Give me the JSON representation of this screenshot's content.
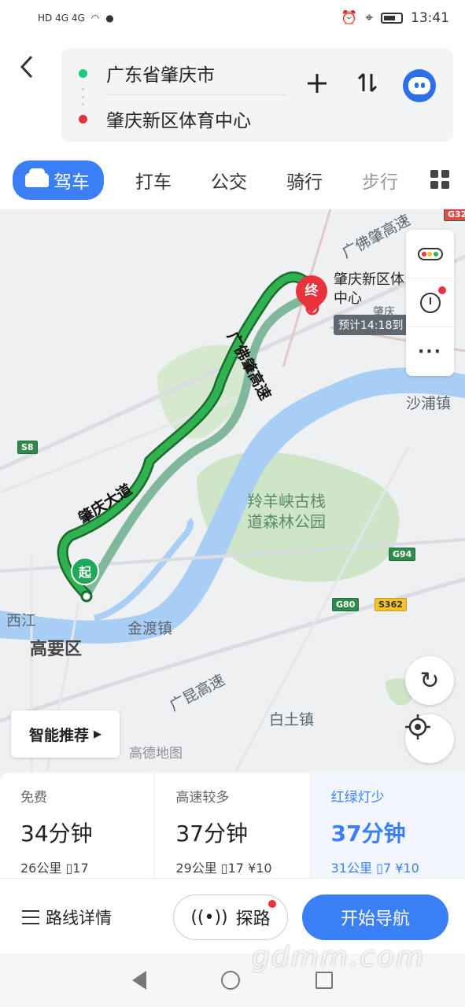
{
  "status_bar": {
    "network": "HD 4G 4G",
    "time": "13:41"
  },
  "header": {
    "back_icon": "chevron-left-icon",
    "start": "广东省肇庆市",
    "end": "肇庆新区体育中心",
    "add_icon": "plus-icon",
    "swap_icon": "swap-vertical-icon",
    "assistant_icon": "robot-icon"
  },
  "mode_tabs": [
    {
      "label": "驾车",
      "active": true
    },
    {
      "label": "打车"
    },
    {
      "label": "公交"
    },
    {
      "label": "骑行"
    },
    {
      "label": "步行"
    }
  ],
  "map": {
    "dest_name": "肇庆新区体育中心",
    "dest_line1": "肇庆新区体",
    "dest_line2": "中心",
    "eta": "预计14:18到",
    "end_marker": "终",
    "start_marker": "起",
    "labels": {
      "guangfo_top": "广佛肇高速",
      "guangfo_route": "广佛肇高速",
      "zhaoqing_avenue": "肇庆大道",
      "shapu": "沙浦镇",
      "park_line1": "羚羊峡古栈",
      "park_line2": "道森林公园",
      "xijiang": "西江",
      "jindu": "金渡镇",
      "gaoyao": "高要区",
      "guangkun": "广昆高速",
      "baitu": "白土镇",
      "zhaoqing_small": "肇庆"
    },
    "badges": {
      "s8": "S8",
      "g94": "G94",
      "g80": "G80",
      "s362": "S362",
      "g32": "G32"
    },
    "smart_recommend": "智能推荐",
    "attribution": "高德地图"
  },
  "route_options": [
    {
      "tag": "免费",
      "time": "34分钟",
      "distance": "26公里",
      "lights": "17",
      "toll": ""
    },
    {
      "tag": "高速较多",
      "time": "37分钟",
      "distance": "29公里",
      "lights": "17",
      "toll": "¥10"
    },
    {
      "tag": "红绿灯少",
      "time": "37分钟",
      "distance": "31公里",
      "lights": "7",
      "toll": "¥10"
    }
  ],
  "actions": {
    "detail": "路线详情",
    "explore": "探路",
    "navigate": "开始导航"
  },
  "watermark": "gdmm.com"
}
